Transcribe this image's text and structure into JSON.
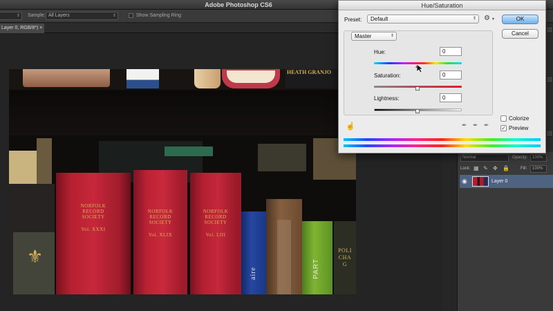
{
  "app": {
    "title": "Adobe Photoshop CS6"
  },
  "options_bar": {
    "size_value": "",
    "sample_label": "Sample:",
    "sample_value": "All Layers",
    "sampling_ring_label": "Show Sampling Ring"
  },
  "document": {
    "tab_label": "Layer 0, RGB/8*) ×"
  },
  "photo": {
    "books": [
      {
        "color": "#a41d2c",
        "lines": [
          "NORFOLK",
          "RECORD",
          "SOCIETY",
          "",
          "Vol. XXXI"
        ]
      },
      {
        "color": "#b11e30",
        "lines": [
          "NORFOLK",
          "RECORD",
          "SOCIETY",
          "",
          "Vol. XLIX"
        ]
      },
      {
        "color": "#a91b2d",
        "lines": [
          "NORFOLK",
          "RECORD",
          "SOCIETY",
          "",
          "Vol. LIII"
        ]
      }
    ],
    "vertical_spines": [
      "aire",
      "PART"
    ],
    "top_shelf_text": "HEATH GRANJO",
    "right_spine_lines": [
      "POLI",
      "CHA",
      "G"
    ]
  },
  "layers_panel": {
    "blend_mode": "Normal",
    "opacity_label": "Opacity:",
    "opacity_value": "100%",
    "lock_label": "Lock:",
    "fill_label": "Fill:",
    "fill_value": "100%",
    "layer_name": "Layer 0"
  },
  "dialog": {
    "title": "Hue/Saturation",
    "preset_label": "Preset:",
    "preset_value": "Default",
    "channel_value": "Master",
    "hue_label": "Hue:",
    "hue_value": "0",
    "saturation_label": "Saturation:",
    "saturation_value": "0",
    "lightness_label": "Lightness:",
    "lightness_value": "0",
    "ok_label": "OK",
    "cancel_label": "Cancel",
    "colorize_label": "Colorize",
    "colorize_checked": false,
    "preview_label": "Preview",
    "preview_checked": true,
    "preview_check_glyph": "✓"
  }
}
